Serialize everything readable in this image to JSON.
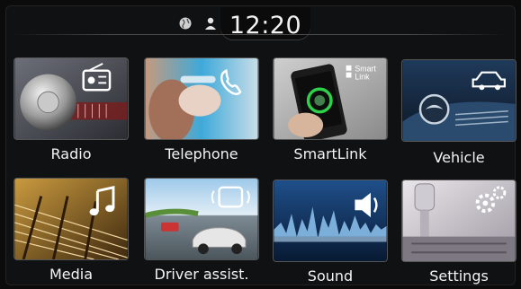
{
  "status_bar": {
    "time": "12:20",
    "left_icon": "globe-icon",
    "right_icon": "user-profile-icon"
  },
  "menu": {
    "items": [
      {
        "label": "Radio",
        "icon": "radio-icon"
      },
      {
        "label": "Telephone",
        "icon": "phone-handset-icon"
      },
      {
        "label": "SmartLink",
        "icon": "smartlink-icon",
        "badge": [
          "Smart",
          "Link"
        ]
      },
      {
        "label": "Vehicle",
        "icon": "car-icon"
      },
      {
        "label": "Media",
        "icon": "music-note-icon"
      },
      {
        "label": "Driver assist.",
        "icon": "driver-assist-car-icon"
      },
      {
        "label": "Sound",
        "icon": "speaker-icon"
      },
      {
        "label": "Settings",
        "icon": "gears-icon"
      }
    ]
  },
  "colors": {
    "background": "#0b0b0b",
    "text": "#f3f3f3",
    "tile_border": "#555555",
    "accent_green": "#2fd04a"
  }
}
